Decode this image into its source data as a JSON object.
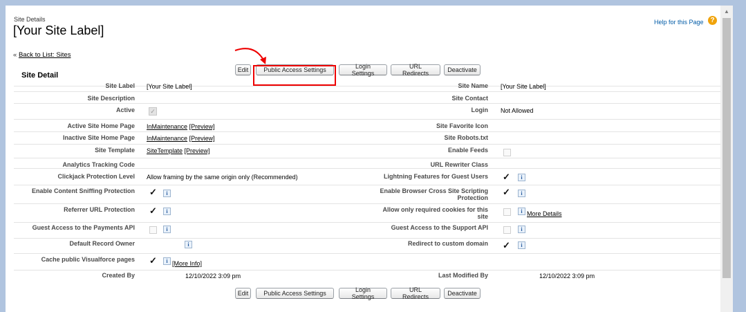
{
  "header": {
    "type_label": "Site Details",
    "title": "[Your Site Label]",
    "help_link": "Help for this Page",
    "help_icon": "question-icon"
  },
  "back": {
    "prefix": "«",
    "link": "Back to List: Sites"
  },
  "section_title": "Site Detail",
  "buttons": {
    "edit": "Edit",
    "public_access": "Public Access Settings",
    "login_settings": "Login Settings",
    "url_redirects": "URL Redirects",
    "deactivate": "Deactivate"
  },
  "fields": {
    "site_label": {
      "label": "Site Label",
      "value": "[Your Site Label]"
    },
    "site_name": {
      "label": "Site Name",
      "value": "[Your Site Label]"
    },
    "site_description": {
      "label": "Site Description"
    },
    "site_contact": {
      "label": "Site Contact"
    },
    "active": {
      "label": "Active",
      "checked": true
    },
    "login": {
      "label": "Login",
      "value": "Not Allowed"
    },
    "active_home": {
      "label": "Active Site Home Page",
      "link": "InMaintenance",
      "preview": "[Preview]"
    },
    "favorite_icon": {
      "label": "Site Favorite Icon"
    },
    "inactive_home": {
      "label": "Inactive Site Home Page",
      "link": "InMaintenance",
      "preview": "[Preview]"
    },
    "robots": {
      "label": "Site Robots.txt"
    },
    "template": {
      "label": "Site Template",
      "link": "SiteTemplate",
      "preview": "[Preview]"
    },
    "enable_feeds": {
      "label": "Enable Feeds",
      "checked": false
    },
    "analytics": {
      "label": "Analytics Tracking Code"
    },
    "url_rewriter": {
      "label": "URL Rewriter Class"
    },
    "clickjack": {
      "label": "Clickjack Protection Level",
      "value": "Allow framing by the same origin only (Recommended)"
    },
    "lightning": {
      "label": "Lightning Features for Guest Users",
      "checked": true
    },
    "sniffing": {
      "label": "Enable Content Sniffing Protection",
      "checked": true
    },
    "xss": {
      "label_line1": "Enable Browser Cross Site Scripting",
      "label_line2": "Protection",
      "checked": true
    },
    "referrer": {
      "label": "Referrer URL Protection",
      "checked": true
    },
    "cookies": {
      "label_line1": "Allow only required cookies for this",
      "label_line2": "site",
      "checked": false,
      "more": "More Details"
    },
    "payments": {
      "label": "Guest Access to the Payments API",
      "checked": false
    },
    "support_api": {
      "label": "Guest Access to the Support API",
      "checked": false
    },
    "record_owner": {
      "label": "Default Record Owner"
    },
    "redirect_domain": {
      "label": "Redirect to custom domain",
      "checked": true
    },
    "cache": {
      "label": "Cache public Visualforce pages",
      "checked": true,
      "more": "[More Info]"
    },
    "created_by": {
      "label": "Created By",
      "value": "12/10/2022 3:09 pm"
    },
    "modified_by": {
      "label": "Last Modified By",
      "value": "12/10/2022 3:09 pm"
    }
  },
  "glyphs": {
    "check": "✓",
    "info": "i",
    "help": "?"
  },
  "colors": {
    "highlight": "#e00000",
    "link": "#015ba7",
    "help_icon": "#f0a30a"
  }
}
